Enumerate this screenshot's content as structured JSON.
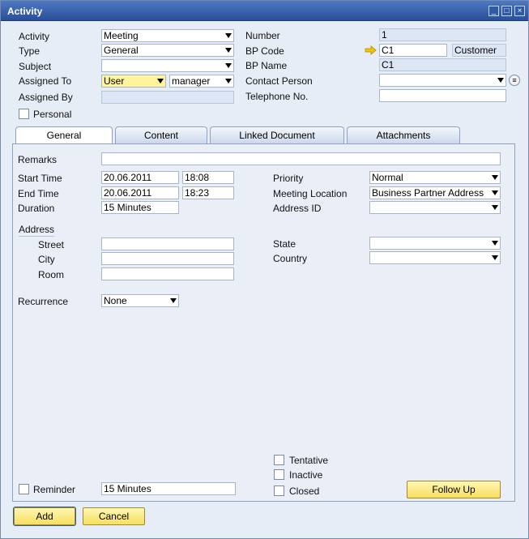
{
  "window": {
    "title": "Activity"
  },
  "header_left": {
    "activity": {
      "label": "Activity",
      "value": "Meeting"
    },
    "type": {
      "label": "Type",
      "value": "General"
    },
    "subject": {
      "label": "Subject",
      "value": ""
    },
    "assigned_to": {
      "label": "Assigned To",
      "value": "User",
      "value2": "manager"
    },
    "assigned_by": {
      "label": "Assigned By",
      "value": ""
    },
    "personal": {
      "label": "Personal",
      "checked": false
    }
  },
  "header_right": {
    "number": {
      "label": "Number",
      "value": "1"
    },
    "bp_code": {
      "label": "BP Code",
      "value": "C1",
      "type_value": "Customer"
    },
    "bp_name": {
      "label": "BP Name",
      "value": "C1"
    },
    "contact_person": {
      "label": "Contact Person",
      "value": ""
    },
    "telephone": {
      "label": "Telephone No.",
      "value": ""
    }
  },
  "tabs": [
    {
      "label": "General",
      "active": true
    },
    {
      "label": "Content",
      "active": false
    },
    {
      "label": "Linked Document",
      "active": false
    },
    {
      "label": "Attachments",
      "active": false
    }
  ],
  "general": {
    "remarks": {
      "label": "Remarks",
      "value": ""
    },
    "start_time": {
      "label": "Start Time",
      "date": "20.06.2011",
      "time": "18:08"
    },
    "end_time": {
      "label": "End Time",
      "date": "20.06.2011",
      "time": "18:23"
    },
    "duration": {
      "label": "Duration",
      "value": "15 Minutes"
    },
    "priority": {
      "label": "Priority",
      "value": "Normal"
    },
    "meeting_location": {
      "label": "Meeting Location",
      "value": "Business Partner Address"
    },
    "address_id": {
      "label": "Address ID",
      "value": ""
    },
    "address_header": "Address",
    "street": {
      "label": "Street",
      "value": ""
    },
    "city": {
      "label": "City",
      "value": ""
    },
    "room": {
      "label": "Room",
      "value": ""
    },
    "state": {
      "label": "State",
      "value": ""
    },
    "country": {
      "label": "Country",
      "value": ""
    },
    "recurrence": {
      "label": "Recurrence",
      "value": "None"
    },
    "tentative": {
      "label": "Tentative",
      "checked": false
    },
    "inactive": {
      "label": "Inactive",
      "checked": false
    },
    "closed": {
      "label": "Closed",
      "checked": false
    },
    "reminder": {
      "label": "Reminder",
      "value": "15 Minutes",
      "checked": false
    },
    "follow_up_label": "Follow Up"
  },
  "footer": {
    "add_label": "Add",
    "cancel_label": "Cancel"
  },
  "colors": {
    "titlebar": "#2a4f97",
    "button": "#f7df5e",
    "highlight_field": "#fff49b"
  }
}
